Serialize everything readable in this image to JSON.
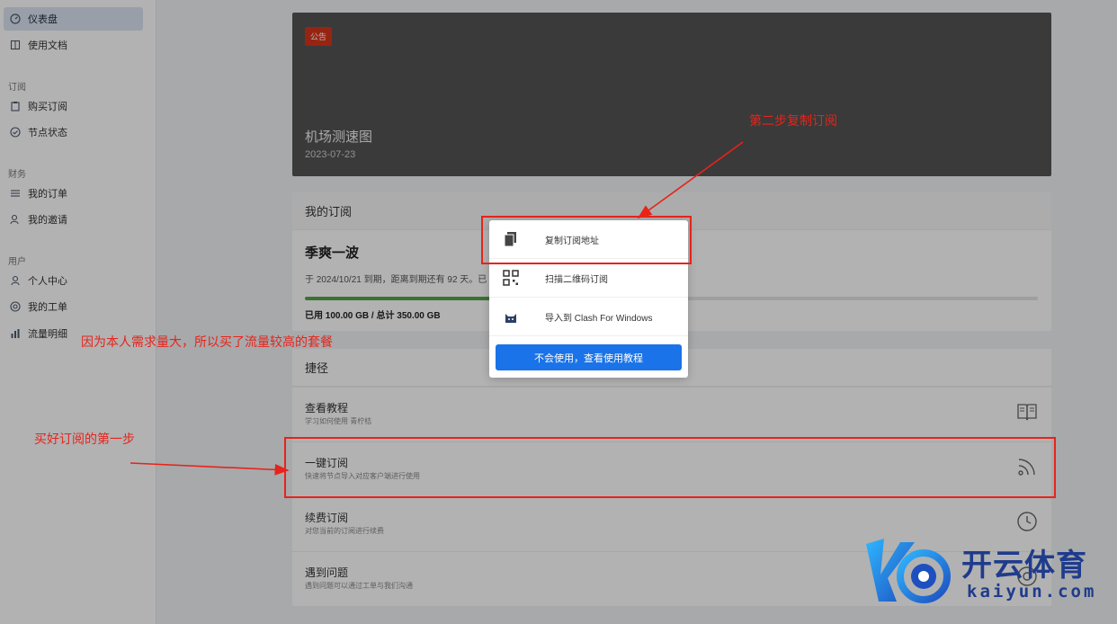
{
  "sidebar": {
    "items": [
      {
        "label": "仪表盘",
        "icon": "dashboard-icon",
        "active": true
      },
      {
        "label": "使用文档",
        "icon": "book-icon"
      },
      {
        "label": "购买订阅",
        "icon": "clipboard-icon"
      },
      {
        "label": "节点状态",
        "icon": "check-circle-icon"
      },
      {
        "label": "我的订单",
        "icon": "list-icon"
      },
      {
        "label": "我的邀请",
        "icon": "user-plus-icon"
      },
      {
        "label": "个人中心",
        "icon": "user-icon"
      },
      {
        "label": "我的工单",
        "icon": "lifebuoy-icon"
      },
      {
        "label": "流量明细",
        "icon": "bar-chart-icon"
      }
    ],
    "groups": [
      "订阅",
      "财务",
      "用户"
    ]
  },
  "banner": {
    "badge": "公告",
    "title": "机场测速图",
    "date": "2023-07-23"
  },
  "subscription": {
    "header": "我的订阅",
    "plan_name": "季爽一波",
    "expiry": "于 2024/10/21 到期，距离到期还有 92 天。已",
    "usage": "已用 100.00 GB / 总计 350.00 GB",
    "used_fraction": 0.286
  },
  "shortcuts": {
    "header": "捷径",
    "items": [
      {
        "title": "查看教程",
        "desc": "学习如何使用 青柠桔",
        "icon": "book-icon"
      },
      {
        "title": "一键订阅",
        "desc": "快速将节点导入对应客户端进行使用",
        "icon": "rss-icon"
      },
      {
        "title": "续费订阅",
        "desc": "对您当前的订阅进行续费",
        "icon": "clock-icon"
      },
      {
        "title": "遇到问题",
        "desc": "遇到问题可以通过工单与我们沟通",
        "icon": "help-icon"
      }
    ]
  },
  "popup": {
    "items": [
      {
        "label": "复制订阅地址",
        "icon": "copy-icon"
      },
      {
        "label": "扫描二维码订阅",
        "icon": "qrcode-icon"
      },
      {
        "label": "导入到 Clash For Windows",
        "icon": "clash-cat-icon"
      }
    ],
    "button": "不会使用，查看使用教程"
  },
  "annotations": {
    "step2": "第二步复制订阅",
    "reason": "因为本人需求量大，所以买了流量较高的套餐",
    "step1": "买好订阅的第一步"
  },
  "watermark": {
    "cn": "开云体育",
    "en": "kaiyun.com"
  },
  "colors": {
    "accent": "#1a73e8",
    "annotation": "#e8231a",
    "badge": "#d9341a",
    "progress": "#52a447"
  }
}
